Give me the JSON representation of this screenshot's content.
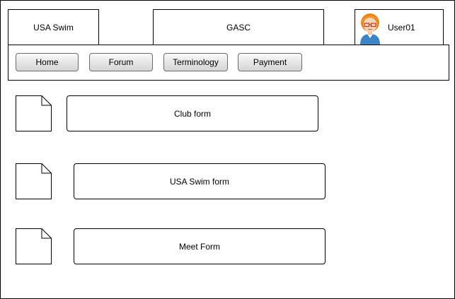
{
  "header": {
    "brand_label": "USA Swim",
    "club_label": "GASC",
    "user": {
      "name": "User01",
      "avatar_icon": "user-avatar-icon"
    }
  },
  "nav": {
    "items": [
      {
        "label": "Home"
      },
      {
        "label": "Forum"
      },
      {
        "label": "Terminology"
      },
      {
        "label": "Payment"
      }
    ]
  },
  "forms": [
    {
      "label": "Club form",
      "icon": "document-icon"
    },
    {
      "label": "USA Swim form",
      "icon": "document-icon"
    },
    {
      "label": "Meet Form",
      "icon": "document-icon"
    }
  ]
}
